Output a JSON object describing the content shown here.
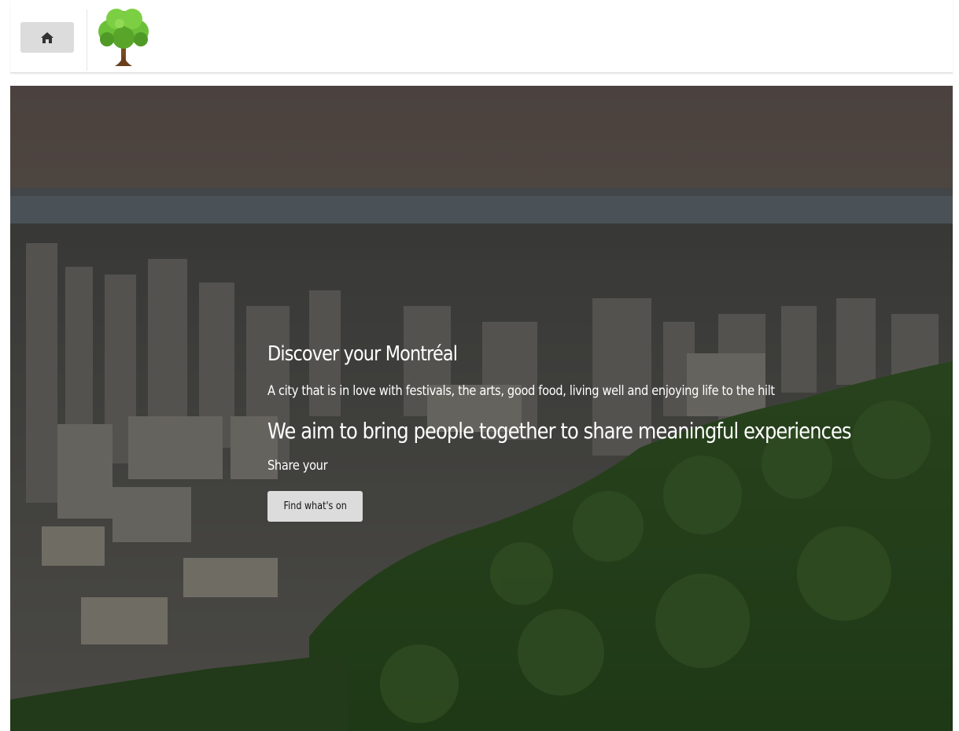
{
  "navbar": {
    "home_icon": "home-icon",
    "logo_icon": "tree-logo-icon"
  },
  "hero": {
    "title": "Discover your Montréal",
    "tagline": "A city that is in love with festivals, the arts, good food, living well and enjoying life to the hilt",
    "mission": "We aim to bring people together to share meaningful experiences",
    "share_text": "Share your",
    "cta_label": "Find what's on"
  },
  "colors": {
    "button_bg": "#dcdcdc",
    "hero_text": "#ffffff",
    "overlay": "#0a0c0a"
  }
}
